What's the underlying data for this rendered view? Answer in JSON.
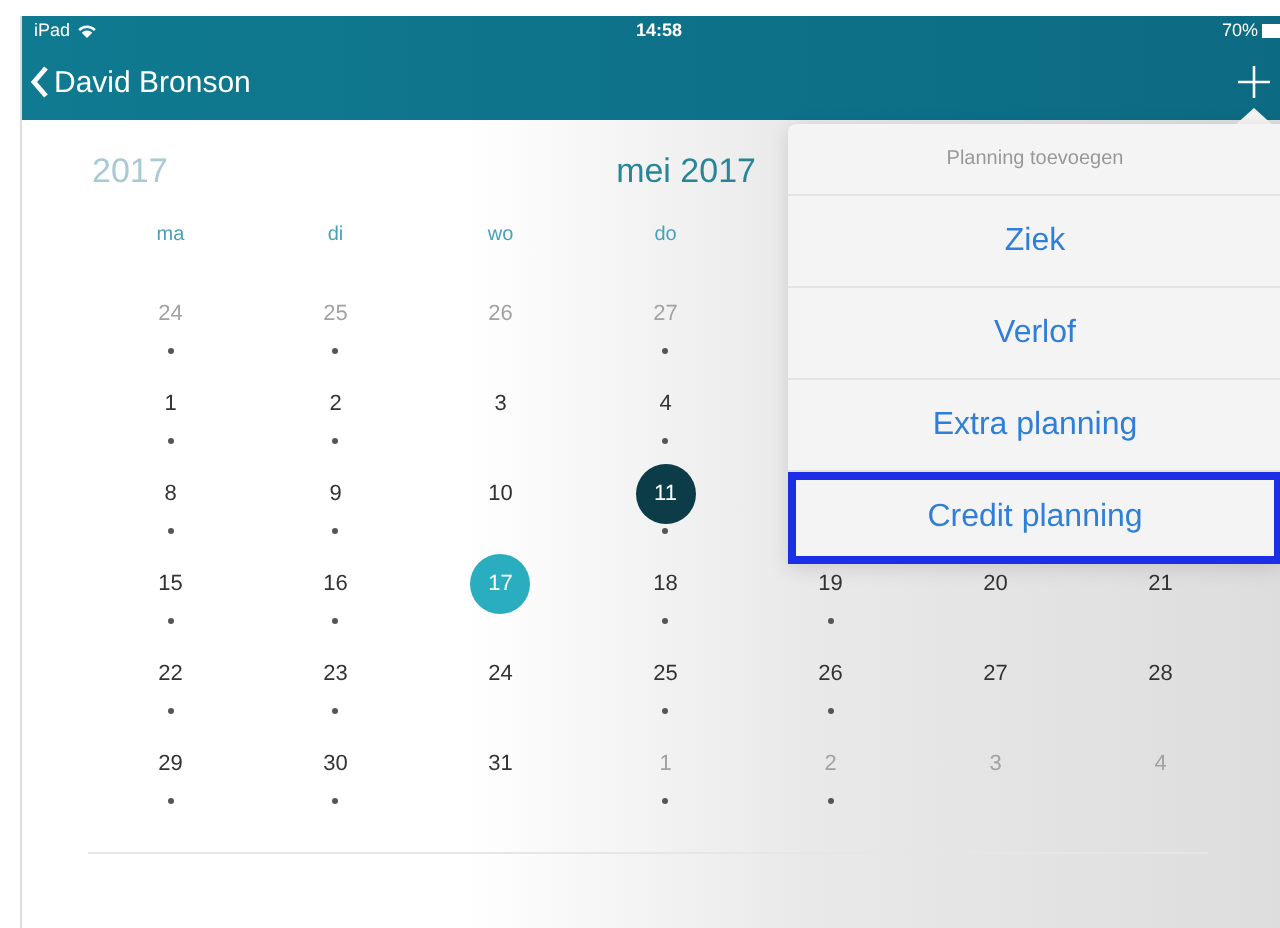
{
  "status_bar": {
    "device": "iPad",
    "time": "14:58",
    "battery": "70%"
  },
  "nav": {
    "back_label": "David Bronson"
  },
  "calendar": {
    "year": "2017",
    "month": "mei 2017",
    "weekdays": [
      "ma",
      "di",
      "wo",
      "do"
    ],
    "weeks": [
      [
        {
          "label": "24",
          "muted": true,
          "dot": true,
          "kind": "normal"
        },
        {
          "label": "25",
          "muted": true,
          "dot": true,
          "kind": "normal"
        },
        {
          "label": "26",
          "muted": true,
          "dot": false,
          "kind": "normal"
        },
        {
          "label": "27",
          "muted": true,
          "dot": true,
          "kind": "normal"
        }
      ],
      [
        {
          "label": "1",
          "muted": false,
          "dot": true,
          "kind": "normal"
        },
        {
          "label": "2",
          "muted": false,
          "dot": true,
          "kind": "normal"
        },
        {
          "label": "3",
          "muted": false,
          "dot": false,
          "kind": "normal"
        },
        {
          "label": "4",
          "muted": false,
          "dot": true,
          "kind": "normal"
        }
      ],
      [
        {
          "label": "8",
          "muted": false,
          "dot": true,
          "kind": "normal"
        },
        {
          "label": "9",
          "muted": false,
          "dot": true,
          "kind": "normal"
        },
        {
          "label": "10",
          "muted": false,
          "dot": false,
          "kind": "normal"
        },
        {
          "label": "11",
          "muted": false,
          "dot": true,
          "kind": "selected"
        }
      ],
      [
        {
          "label": "15",
          "muted": false,
          "dot": true,
          "kind": "normal"
        },
        {
          "label": "16",
          "muted": false,
          "dot": true,
          "kind": "normal"
        },
        {
          "label": "17",
          "muted": false,
          "dot": false,
          "kind": "today"
        },
        {
          "label": "18",
          "muted": false,
          "dot": true,
          "kind": "normal"
        },
        {
          "label": "19",
          "muted": false,
          "dot": true,
          "kind": "normal"
        },
        {
          "label": "20",
          "muted": false,
          "dot": false,
          "kind": "normal"
        },
        {
          "label": "21",
          "muted": false,
          "dot": false,
          "kind": "normal"
        }
      ],
      [
        {
          "label": "22",
          "muted": false,
          "dot": true,
          "kind": "normal"
        },
        {
          "label": "23",
          "muted": false,
          "dot": true,
          "kind": "normal"
        },
        {
          "label": "24",
          "muted": false,
          "dot": false,
          "kind": "normal"
        },
        {
          "label": "25",
          "muted": false,
          "dot": true,
          "kind": "normal"
        },
        {
          "label": "26",
          "muted": false,
          "dot": true,
          "kind": "normal"
        },
        {
          "label": "27",
          "muted": false,
          "dot": false,
          "kind": "normal"
        },
        {
          "label": "28",
          "muted": false,
          "dot": false,
          "kind": "normal"
        }
      ],
      [
        {
          "label": "29",
          "muted": false,
          "dot": true,
          "kind": "normal"
        },
        {
          "label": "30",
          "muted": false,
          "dot": true,
          "kind": "normal"
        },
        {
          "label": "31",
          "muted": false,
          "dot": false,
          "kind": "normal"
        },
        {
          "label": "1",
          "muted": true,
          "dot": true,
          "kind": "normal"
        },
        {
          "label": "2",
          "muted": true,
          "dot": true,
          "kind": "normal"
        },
        {
          "label": "3",
          "muted": true,
          "dot": false,
          "kind": "normal"
        },
        {
          "label": "4",
          "muted": true,
          "dot": false,
          "kind": "normal"
        }
      ]
    ]
  },
  "popover": {
    "title": "Planning toevoegen",
    "items": [
      {
        "label": "Ziek",
        "highlighted": false
      },
      {
        "label": "Verlof",
        "highlighted": false
      },
      {
        "label": "Extra planning",
        "highlighted": false
      },
      {
        "label": "Credit planning",
        "highlighted": true
      }
    ]
  }
}
